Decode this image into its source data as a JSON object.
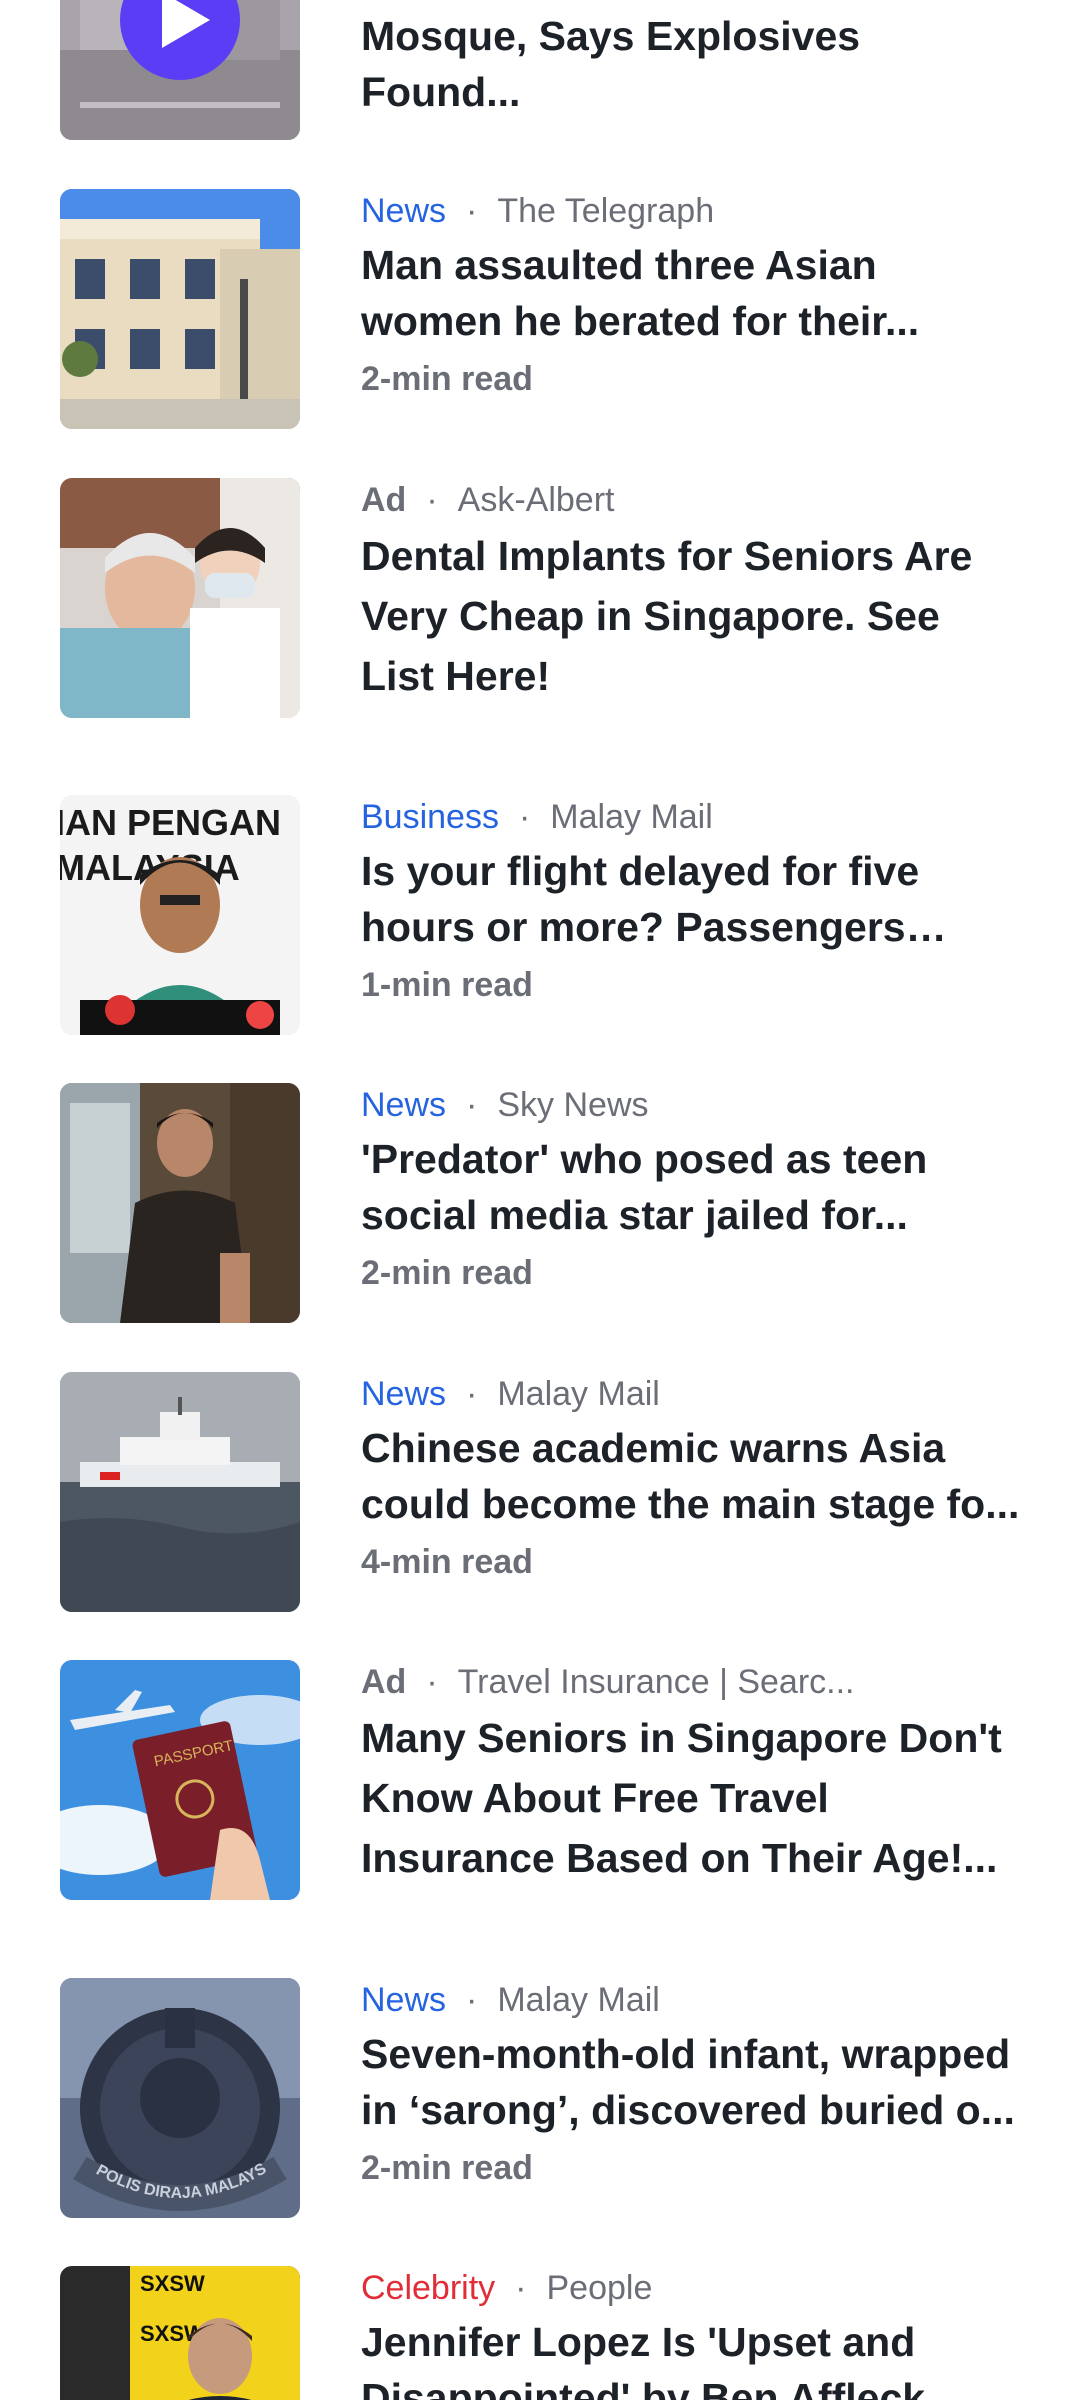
{
  "colors": {
    "news": "#2563e0",
    "business": "#2563e0",
    "celebrity": "#e02d37",
    "ad": "#6b6e76"
  },
  "items": [
    {
      "headline": "Mosque, Says Explosives Found..."
    },
    {
      "category": "News",
      "source": "The Telegraph",
      "headline": "Man assaulted three Asian women he berated for their...",
      "readtime": "2-min read"
    },
    {
      "category": "Ad",
      "source": "Ask-Albert",
      "headline": "Dental Implants for Seniors Are Very Cheap in Singapore. See List Here!"
    },
    {
      "category": "Business",
      "source": "Malay Mail",
      "headline": "Is your flight delayed for five hours or more? Passengers can...",
      "readtime": "1-min read",
      "thumb_text": [
        "IAN PENGAN",
        "MALAYSIA"
      ]
    },
    {
      "category": "News",
      "source": "Sky News",
      "headline": "'Predator' who posed as teen social media star jailed for...",
      "readtime": "2-min read"
    },
    {
      "category": "News",
      "source": "Malay Mail",
      "headline": "Chinese academic warns Asia could become the main stage fo...",
      "readtime": "4-min read"
    },
    {
      "category": "Ad",
      "source": "Travel Insurance | Searc...",
      "headline": "Many Seniors in Singapore Don't Know About Free Travel Insurance Based on Their Age!...",
      "thumb_text": [
        "PASSPORT"
      ]
    },
    {
      "category": "News",
      "source": "Malay Mail",
      "headline": "Seven-month-old infant, wrapped in ‘sarong’, discovered buried o...",
      "readtime": "2-min read",
      "thumb_text": [
        "POLIS DIRAJA MALAYSIA"
      ]
    },
    {
      "category": "Celebrity",
      "source": "People",
      "headline": "Jennifer Lopez Is 'Upset and Disappointed' by Ben Affleck...",
      "thumb_text": [
        "SXSW",
        "SXSW"
      ]
    }
  ]
}
